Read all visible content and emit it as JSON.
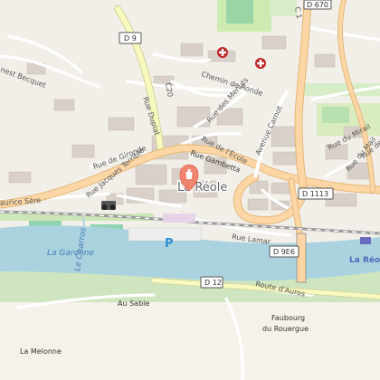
{
  "map": {
    "town_label": "La Réole",
    "station_label": "La Réo",
    "river_label": "La Garonne",
    "stream_label": "Le Charros",
    "parking_symbol": "P",
    "streets": {
      "rue_gambetta": "Rue Gambetta",
      "avenue_carnot": "Avenue Carnot",
      "rue_de_gironde": "Rue de Gironde",
      "rue_jacques_terrible": "Rue Jacques Terrible",
      "rue_de_lecole": "Rue de l'École",
      "rue_des_menuts": "Rue des Menuts",
      "chemin_de_ronde": "Chemin de Ronde",
      "rue_duplat": "Rue Duplat",
      "rue_lamar": "Rue Lamar",
      "rue_du_mirail": "Rue du Mirail",
      "rue_du_mail": "Rue du Mail",
      "rue_de_la": "Rue de la",
      "route_dauros": "Route d'Auros",
      "maurice_sere": "aurice Sère",
      "ernest_becquet": "nest Becquet"
    },
    "places": {
      "au_sable": "Au Sable",
      "la_melonne": "La Melonne",
      "faubourg_line1": "Faubourg",
      "faubourg_line2": "du Rouergue"
    },
    "road_refs": [
      "D 9",
      "C20",
      "D 670",
      "D 1113",
      "D 9E6",
      "D 12",
      "C 1"
    ],
    "icons": {
      "pharmacy": "pharmacy-cross-icon",
      "location_pin": "location-pin-icon",
      "viewpoint": "binoculars-icon",
      "parking": "parking-icon"
    },
    "colors": {
      "background": "#f2efe9",
      "water": "#aad3df",
      "primary_road": "#fcd6a4",
      "road_casing": "#e4b77a",
      "secondary_road": "#f7fabf",
      "green": "#add19e",
      "pin": "#f0846e",
      "pharmacy": "#bf2626",
      "railway": "#9a9a9a"
    }
  }
}
